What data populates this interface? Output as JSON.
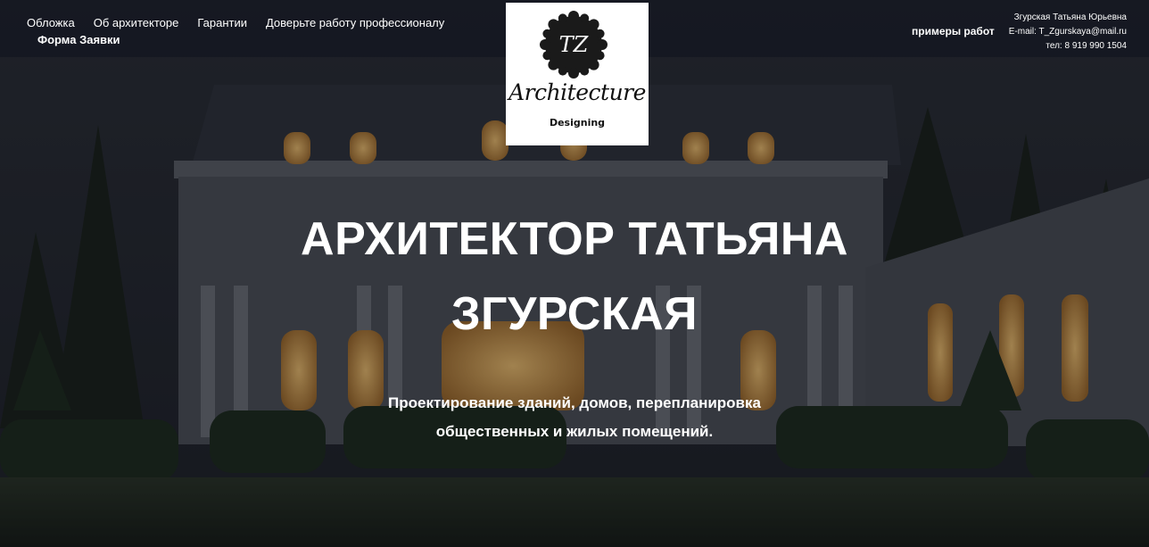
{
  "nav": {
    "items": [
      "Обложка",
      "Об архитекторе",
      "Гарантии",
      "Доверьте работу профессионалу"
    ],
    "form_link": "Форма Заявки"
  },
  "logo": {
    "monogram": "TZ",
    "script": "Architecture",
    "sub": "Designing"
  },
  "works_link": "примеры работ",
  "contacts": {
    "name": "Згурская Татьяна Юрьевна",
    "email": "E-mail:  T_Zgurskaya@mail.ru",
    "phone": "тел:  8 919 990 1504"
  },
  "hero": {
    "title_line1": "АРХИТЕКТОР ТАТЬЯНА",
    "title_line2": "ЗГУРСКАЯ",
    "subtitle_line1": "Проектирование зданий, домов, перепланировка",
    "subtitle_line2": "общественных и жилых помещений."
  },
  "colors": {
    "overlay": "#0e121e",
    "text": "#ffffff",
    "logo_seal": "#1a1a1a",
    "window_glow": "#e8b35a"
  }
}
